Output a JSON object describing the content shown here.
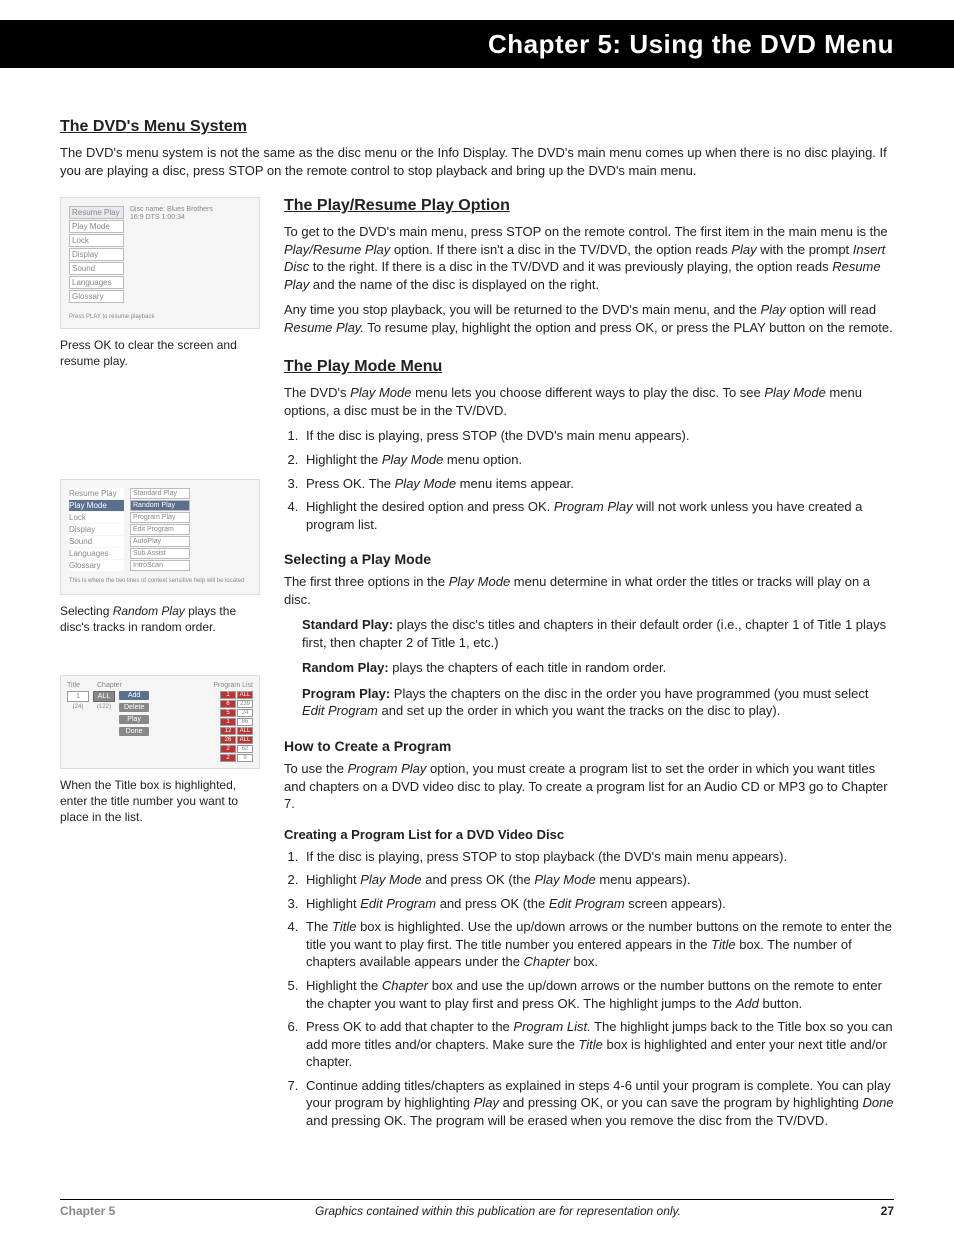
{
  "header": {
    "title": "Chapter 5: Using the DVD Menu"
  },
  "section1": {
    "title": "The DVD's Menu System",
    "p1": "The DVD's menu system is not the same as the disc menu or the Info Display. The DVD's main menu comes up when there is no disc playing. If you are playing a disc, press STOP on the remote control to stop playback and bring up the DVD's main menu."
  },
  "fig1": {
    "menu": [
      "Resume Play",
      "Play Mode",
      "Lock",
      "Display",
      "Sound",
      "Languages",
      "Glossary"
    ],
    "info1": "Disc name: Blues Brothers",
    "info2": "16:9 DTS  1:00:34",
    "foot": "Press PLAY to resume playback",
    "caption": "Press OK to clear the screen and resume play."
  },
  "section2": {
    "title": "The Play/Resume Play Option",
    "p1_a": "To get to the DVD's main menu, press STOP on the remote control. The first item in the main menu is the ",
    "p1_b": "Play/Resume Play",
    "p1_c": " option. If there isn't a disc in the TV/DVD, the option reads ",
    "p1_d": "Play",
    "p1_e": " with the prompt ",
    "p1_f": "Insert Disc",
    "p1_g": " to the right. If there is a disc in the TV/DVD and it was previously playing, the option reads ",
    "p1_h": "Resume Play",
    "p1_i": " and the name of the disc is displayed on the right.",
    "p2_a": "Any time you stop playback, you will be returned to the DVD's main menu, and the ",
    "p2_b": "Play",
    "p2_c": " option will read ",
    "p2_d": "Resume Play.",
    "p2_e": " To resume play, highlight the option and press OK, or press the PLAY button on the remote."
  },
  "section3": {
    "title": "The Play Mode Menu",
    "p1_a": "The DVD's ",
    "p1_b": "Play Mode",
    "p1_c": " menu lets you choose different ways to play the disc. To see ",
    "p1_d": "Play Mode",
    "p1_e": " menu options, a disc must be in the TV/DVD.",
    "steps": {
      "s1": "If the disc is playing, press STOP (the DVD's main menu appears).",
      "s2_a": "Highlight the ",
      "s2_b": "Play Mode",
      "s2_c": " menu option.",
      "s3_a": "Press OK. The ",
      "s3_b": "Play Mode",
      "s3_c": " menu items appear.",
      "s4_a": "Highlight the desired option and press OK. ",
      "s4_b": "Program Play",
      "s4_c": " will not work unless you have created a program list."
    }
  },
  "fig2": {
    "leftmenu": [
      "Resume Play",
      "Play Mode",
      "Lock",
      "Display",
      "Sound",
      "Languages",
      "Glossary"
    ],
    "rightmenu": [
      "Standard Play",
      "Random Play",
      "Program Play",
      "Edit Program",
      "AutoPlay",
      "Sub Assist",
      "IntroScan"
    ],
    "foot": "This is where the two lines of context sensitive help will be located",
    "caption_a": "Selecting ",
    "caption_b": "Random Play",
    "caption_c": " plays the disc's tracks in random order."
  },
  "section4": {
    "title": "Selecting a Play Mode",
    "p1_a": "The first three options in the ",
    "p1_b": "Play Mode",
    "p1_c": " menu determine in what order the titles or tracks will play on a disc.",
    "sp_a": "Standard Play:",
    "sp_b": " plays the disc's titles and chapters in their default order (i.e., chapter 1 of Title 1 plays first, then chapter 2 of Title 1, etc.)",
    "rp_a": "Random Play:",
    "rp_b": " plays the chapters of each title in random order.",
    "pp_a": "Program Play:",
    "pp_b": "  Plays the chapters on the disc in the order you have programmed (you must select ",
    "pp_c": "Edit Program",
    "pp_d": " and set up the order in which you want the tracks on the disc to play)."
  },
  "section5": {
    "title": "How to Create a Program",
    "p1_a": "To use the ",
    "p1_b": "Program Play",
    "p1_c": " option, you must create a program list to set the order in which you want titles and chapters on a DVD video disc to play. To create a program list for an Audio CD or MP3 go to Chapter 7."
  },
  "fig3": {
    "title_lbl": "Title",
    "chapter_lbl": "Chapter",
    "prog_lbl": "Program List",
    "title_val": "1",
    "chap_val": "ALL",
    "btns": [
      "Add",
      "Delete",
      "Play",
      "Done"
    ],
    "small_l": "(24)",
    "small_r": "(122)",
    "list": [
      [
        "1",
        "ALL"
      ],
      [
        "6",
        "239"
      ],
      [
        "5",
        "24"
      ],
      [
        "1",
        "86"
      ],
      [
        "12",
        "ALL"
      ],
      [
        "26",
        "ALL"
      ],
      [
        "2",
        "62"
      ],
      [
        "2",
        "9"
      ]
    ],
    "caption": "When the Title box is highlighted, enter the title number you want to place in the list."
  },
  "section6": {
    "title": "Creating a Program List for a DVD Video Disc",
    "s1": "If the disc is playing, press STOP to stop playback (the DVD's main menu appears).",
    "s2_a": "Highlight ",
    "s2_b": "Play Mode",
    "s2_c": " and press OK (the ",
    "s2_d": "Play Mode",
    "s2_e": " menu appears).",
    "s3_a": "Highlight ",
    "s3_b": "Edit Program",
    "s3_c": " and press OK (the ",
    "s3_d": "Edit Program",
    "s3_e": " screen appears).",
    "s4_a": "The ",
    "s4_b": "Title",
    "s4_c": " box is highlighted. Use the up/down arrows or the number buttons on the remote to enter the title you want to play first. The title number you entered appears in the ",
    "s4_d": "Title",
    "s4_e": " box. The number of chapters available appears under the ",
    "s4_f": "Chapter",
    "s4_g": " box.",
    "s5_a": "Highlight the ",
    "s5_b": "Chapter",
    "s5_c": " box and use the up/down arrows or the number buttons on the remote to enter the chapter you want to play first and press OK. The highlight jumps to the ",
    "s5_d": "Add",
    "s5_e": " button.",
    "s6_a": "Press OK to add that chapter to the ",
    "s6_b": "Program List.",
    "s6_c": " The highlight jumps back to the Title box so you can add more titles and/or chapters. Make sure the ",
    "s6_d": "Title",
    "s6_e": " box is highlighted and enter your next title and/or chapter.",
    "s7_a": "Continue adding titles/chapters as explained in steps 4-6 until your program is complete. You can play your program by highlighting ",
    "s7_b": "Play",
    "s7_c": " and pressing OK, or you can save the program by highlighting ",
    "s7_d": "Done",
    "s7_e": " and pressing OK. The program will be erased when you remove the disc from the TV/DVD."
  },
  "footer": {
    "chapter": "Chapter 5",
    "mid": "Graphics contained within this publication are for representation only.",
    "page": "27"
  }
}
